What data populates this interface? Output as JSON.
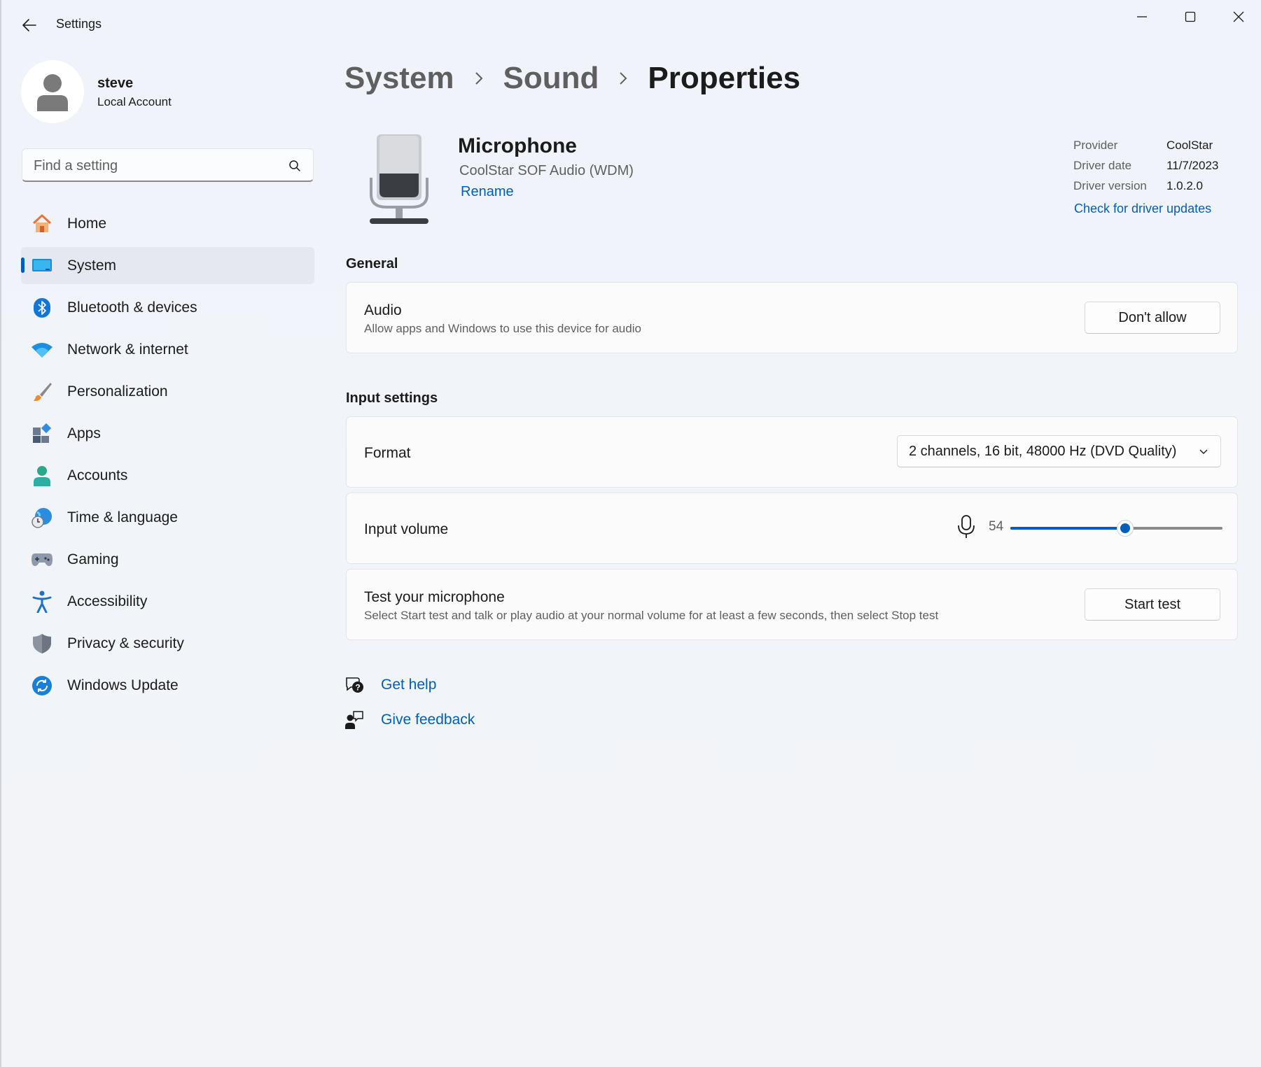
{
  "window": {
    "app_title": "Settings"
  },
  "profile": {
    "name": "steve",
    "account_type": "Local Account"
  },
  "search": {
    "placeholder": "Find a setting"
  },
  "sidebar": {
    "items": [
      {
        "label": "Home",
        "icon": "home-icon"
      },
      {
        "label": "System",
        "icon": "system-icon",
        "selected": true
      },
      {
        "label": "Bluetooth & devices",
        "icon": "bluetooth-icon"
      },
      {
        "label": "Network & internet",
        "icon": "wifi-icon"
      },
      {
        "label": "Personalization",
        "icon": "brush-icon"
      },
      {
        "label": "Apps",
        "icon": "apps-icon"
      },
      {
        "label": "Accounts",
        "icon": "person-icon"
      },
      {
        "label": "Time & language",
        "icon": "globe-clock-icon"
      },
      {
        "label": "Gaming",
        "icon": "gamepad-icon"
      },
      {
        "label": "Accessibility",
        "icon": "accessibility-icon"
      },
      {
        "label": "Privacy & security",
        "icon": "shield-icon"
      },
      {
        "label": "Windows Update",
        "icon": "update-icon"
      }
    ]
  },
  "breadcrumb": [
    "System",
    "Sound",
    "Properties"
  ],
  "device": {
    "name": "Microphone",
    "driver_name": "CoolStar SOF Audio (WDM)",
    "rename_label": "Rename"
  },
  "driver": {
    "rows": [
      {
        "label": "Provider",
        "value": "CoolStar"
      },
      {
        "label": "Driver date",
        "value": "11/7/2023"
      },
      {
        "label": "Driver version",
        "value": "1.0.2.0"
      }
    ],
    "update_link": "Check for driver updates"
  },
  "general": {
    "title": "General",
    "audio": {
      "title": "Audio",
      "description": "Allow apps and Windows to use this device for audio",
      "button": "Don't allow"
    }
  },
  "input_settings": {
    "title": "Input settings",
    "format": {
      "title": "Format",
      "value": "2 channels, 16 bit, 48000 Hz (DVD Quality)"
    },
    "volume": {
      "title": "Input volume",
      "value": "54",
      "level_percent": 54
    },
    "test": {
      "title": "Test your microphone",
      "description": "Select Start test and talk or play audio at your normal volume for at least a few seconds, then select Stop test",
      "button": "Start test"
    }
  },
  "help": {
    "get_help": "Get help",
    "give_feedback": "Give feedback"
  },
  "colors": {
    "accent": "#005fb8",
    "background": "#f0f3f9",
    "card": "#fbfbfc"
  }
}
